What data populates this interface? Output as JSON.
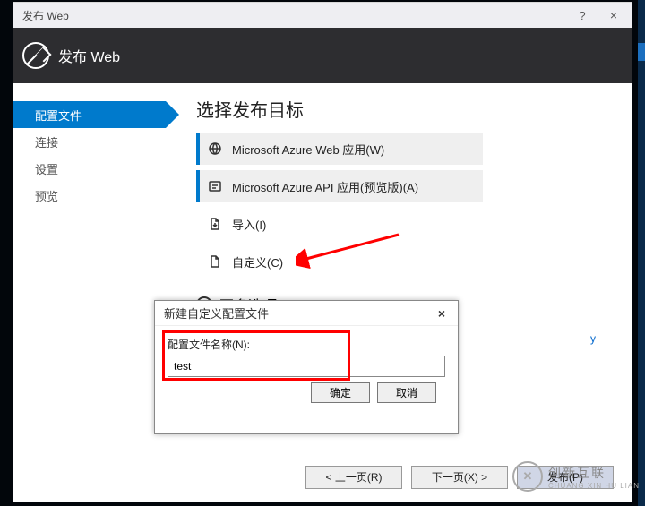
{
  "window": {
    "title": "发布 Web",
    "help": "?",
    "close": "×"
  },
  "header": {
    "title": "发布 Web"
  },
  "sidebar": {
    "items": [
      {
        "label": "配置文件",
        "active": true
      },
      {
        "label": "连接"
      },
      {
        "label": "设置"
      },
      {
        "label": "预览"
      }
    ]
  },
  "main": {
    "title": "选择发布目标",
    "targets": [
      {
        "label": "Microsoft Azure Web 应用(W)"
      },
      {
        "label": "Microsoft Azure API 应用(预览版)(A)"
      },
      {
        "label": "导入(I)"
      },
      {
        "label": "自定义(C)"
      }
    ],
    "more": "更多选项"
  },
  "privacy_link": "y",
  "footer": {
    "prev": "< 上一页(R)",
    "next": "下一页(X) >",
    "publish": "发布(P)"
  },
  "dialog": {
    "title": "新建自定义配置文件",
    "label": "配置文件名称(N):",
    "value": "test",
    "ok": "确定",
    "cancel": "取消",
    "close": "×"
  },
  "watermark": {
    "cn": "创新互联",
    "en": "CHUANG XIN HU LIAN"
  }
}
